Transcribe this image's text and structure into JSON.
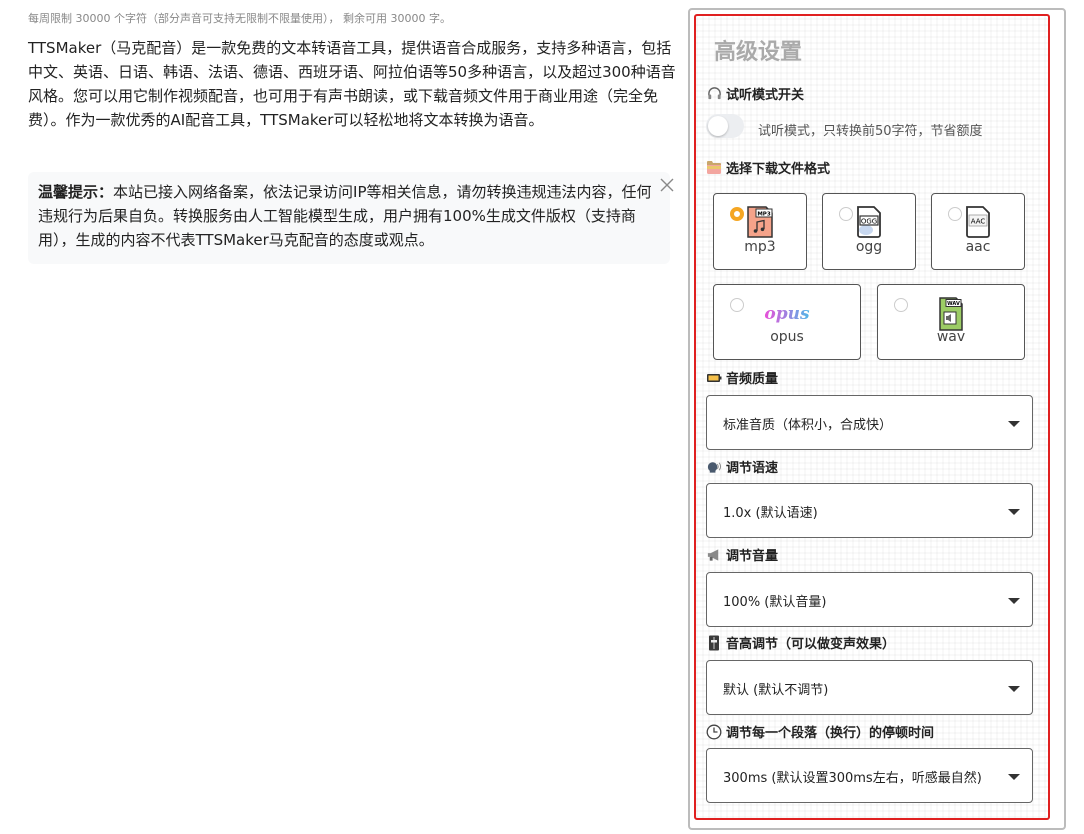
{
  "quota_text": "每周限制 30000 个字符（部分声音可支持无限制不限量使用）， 剩余可用 30000 字。",
  "intro_text": "TTSMaker（马克配音）是一款免费的文本转语音工具，提供语音合成服务，支持多种语言，包括中文、英语、日语、韩语、法语、德语、西班牙语、阿拉伯语等50多种语言，以及超过300种语音风格。您可以用它制作视频配音，也可用于有声书朗读，或下载音频文件用于商业用途（完全免费）。作为一款优秀的AI配音工具，TTSMaker可以轻松地将文本转换为语音。",
  "tip": {
    "label": "温馨提示：",
    "text": "本站已接入网络备案，依法记录访问IP等相关信息，请勿转换违规违法内容，任何违规行为后果自负。转换服务由人工智能模型生成，用户拥有100%生成文件版权（支持商用），生成的内容不代表TTSMaker马克配音的态度或观点。"
  },
  "panel": {
    "title": "高级设置",
    "preview": {
      "label": "试听模式开关",
      "icon": "headphones-icon",
      "toggle_on": false,
      "toggle_text": "试听模式，只转换前50字符，节省额度"
    },
    "format": {
      "label": "选择下载文件格式",
      "icon": "folder-icon",
      "options": [
        {
          "name": "mp3",
          "icon_text": "MP3",
          "checked": true
        },
        {
          "name": "ogg",
          "icon_text": "OGG",
          "checked": false
        },
        {
          "name": "aac",
          "icon_text": "AAC",
          "checked": false
        },
        {
          "name": "opus",
          "icon_text": "opus",
          "checked": false
        },
        {
          "name": "wav",
          "icon_text": "WAV",
          "checked": false
        }
      ]
    },
    "quality": {
      "label": "音频质量",
      "icon": "battery-icon",
      "value": "标准音质（体积小，合成快）"
    },
    "speed": {
      "label": "调节语速",
      "icon": "speaking-head-icon",
      "value": "1.0x (默认语速)"
    },
    "volume": {
      "label": "调节音量",
      "icon": "megaphone-icon",
      "value": "100% (默认音量)"
    },
    "pitch": {
      "label": "音高调节（可以做变声效果）",
      "icon": "level-slider-icon",
      "value": "默认 (默认不调节)"
    },
    "pause": {
      "label": "调节每一个段落（换行）的停顿时间",
      "icon": "clock-icon",
      "value": "300ms (默认设置300ms左右，听感最自然)"
    }
  },
  "colors": {
    "accent": "#f5a623",
    "highlight_border": "#e02020",
    "opus_gradient_start": "#e84fd8",
    "opus_gradient_end": "#4fb8e8"
  }
}
